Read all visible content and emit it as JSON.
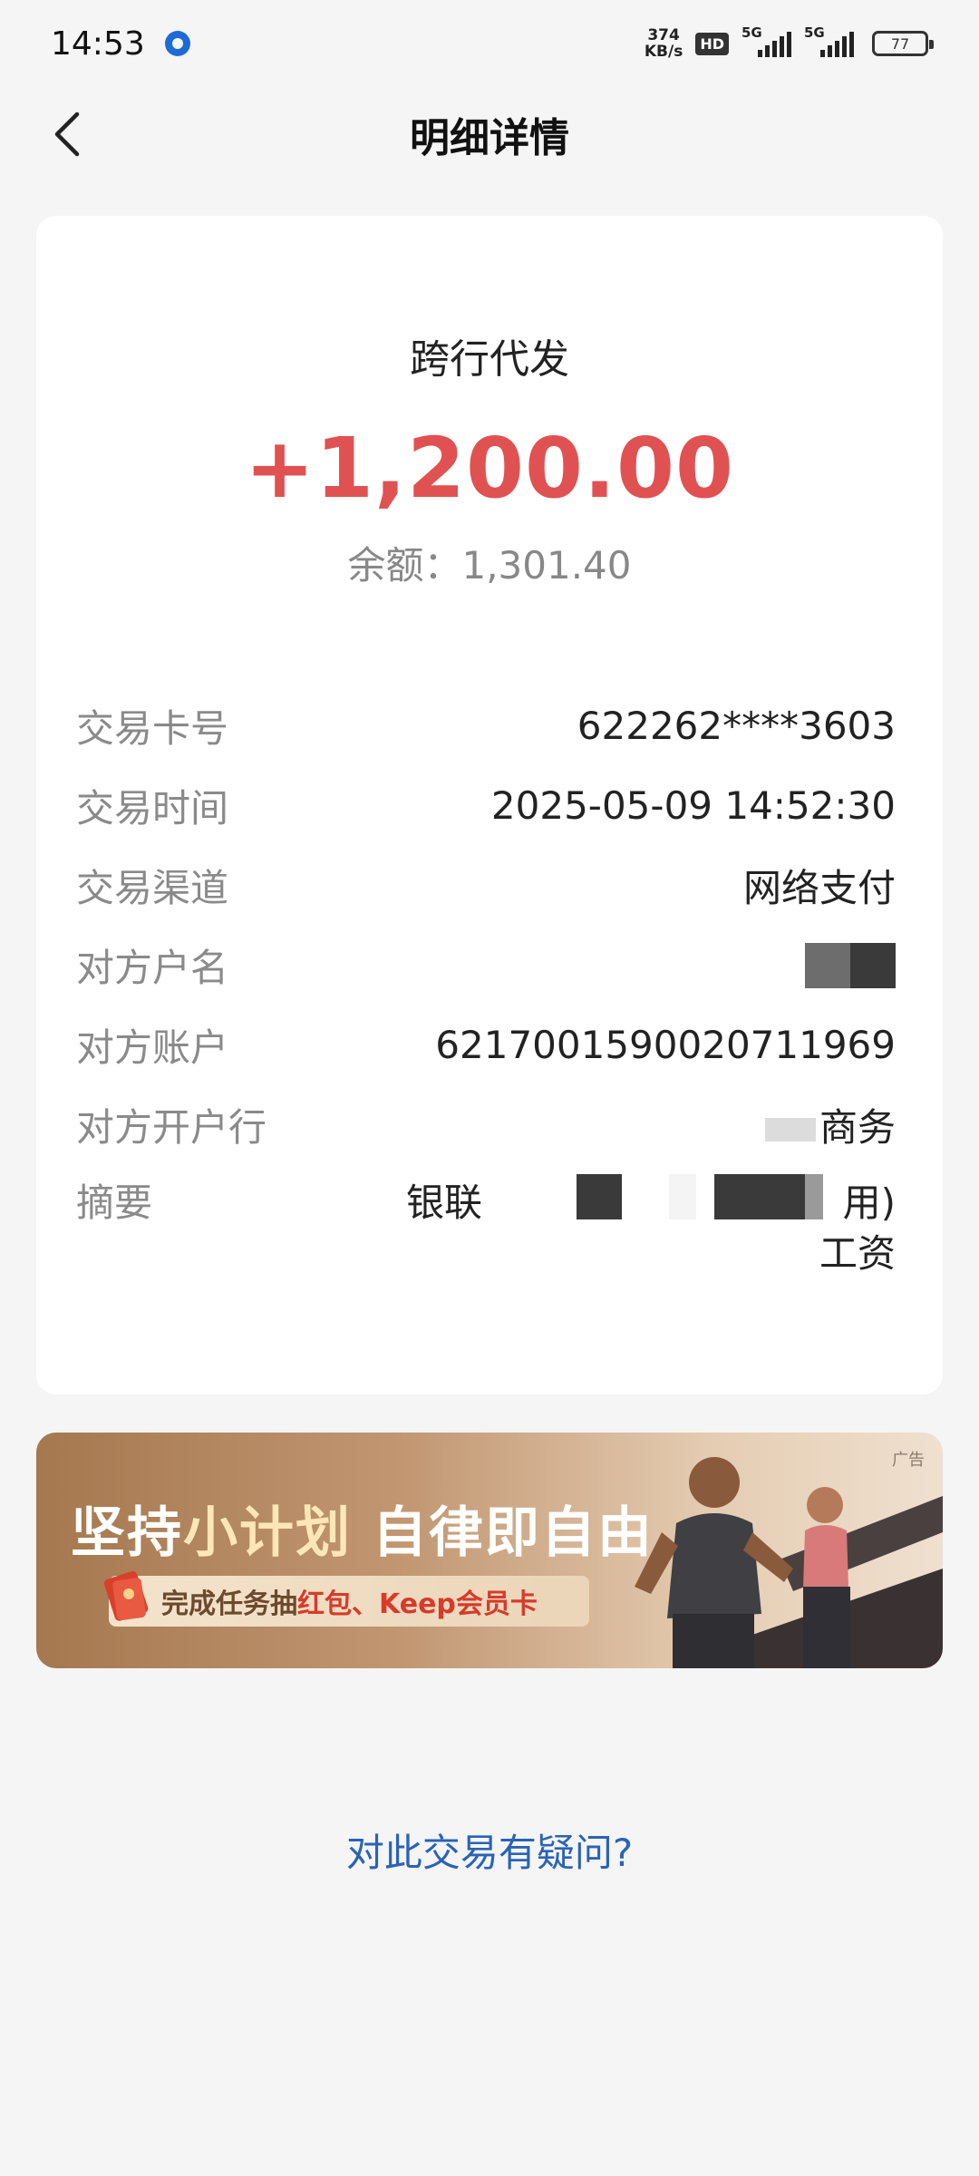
{
  "status_bar": {
    "time": "14:53",
    "net_speed_value": "374",
    "net_speed_unit": "KB/s",
    "hd_label": "HD",
    "signal1_label": "5G",
    "signal2_label": "5G",
    "battery": "77"
  },
  "nav": {
    "title": "明细详情",
    "back_icon": "chevron-left-icon"
  },
  "transaction": {
    "type": "跨行代发",
    "amount": "+1,200.00",
    "balance": "余额：1,301.40",
    "amount_color": "#e05252",
    "rows": [
      {
        "label": "交易卡号",
        "value": "622262****3603"
      },
      {
        "label": "交易时间",
        "value": "2025-05-09 14:52:30"
      },
      {
        "label": "交易渠道",
        "value": "网络支付"
      },
      {
        "label": "对方户名",
        "value": ""
      },
      {
        "label": "对方账户",
        "value": "6217001590020711969"
      },
      {
        "label": "对方开户行",
        "value": "商务"
      },
      {
        "label": "摘要",
        "value_line1_start": "银联",
        "value_line1_end": "用)",
        "value_line2": "工资"
      }
    ]
  },
  "ad": {
    "tag": "广告",
    "headline_part1": "坚持",
    "headline_highlight": "小计划",
    "headline_part2": " 自律即自由",
    "sub_part1": "完成任务抽",
    "sub_highlight": "红包、Keep会员卡"
  },
  "footer": {
    "question_link": "对此交易有疑问?",
    "link_color": "#2a63b5"
  }
}
